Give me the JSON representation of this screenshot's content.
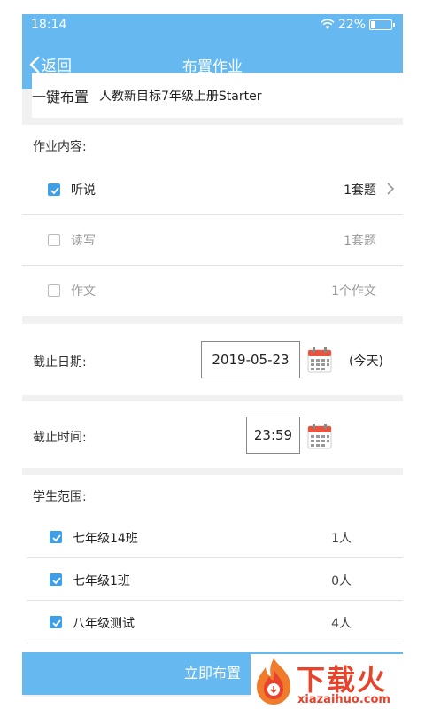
{
  "status": {
    "time": "18:14",
    "battery": "22%"
  },
  "nav": {
    "back_label": "返回",
    "title": "布置作业"
  },
  "quick_assign": {
    "label": "一键布置",
    "textbook": "人教新目标7年级上册Starter"
  },
  "content": {
    "label": "作业内容:",
    "items": [
      {
        "name": "听说",
        "count": "1套题",
        "checked": true
      },
      {
        "name": "读写",
        "count": "1套题",
        "checked": false
      },
      {
        "name": "作文",
        "count": "1个作文",
        "checked": false
      }
    ]
  },
  "deadline_date": {
    "label": "截止日期:",
    "value": "2019-05-23",
    "note": "(今天)"
  },
  "deadline_time": {
    "label": "截止时间:",
    "value": "23:59"
  },
  "students": {
    "label": "学生范围:",
    "classes": [
      {
        "name": "七年级14班",
        "count": "1人",
        "checked": true
      },
      {
        "name": "七年级1班",
        "count": "0人",
        "checked": true
      },
      {
        "name": "八年级测试",
        "count": "4人",
        "checked": true
      }
    ]
  },
  "submit_label": "立即布置",
  "watermark": {
    "cn": "下载火",
    "en": "xiazaihuo.com"
  },
  "colors": {
    "primary": "#66b9f0",
    "checkbox": "#3d9fe8",
    "watermark": "#e8432c"
  }
}
